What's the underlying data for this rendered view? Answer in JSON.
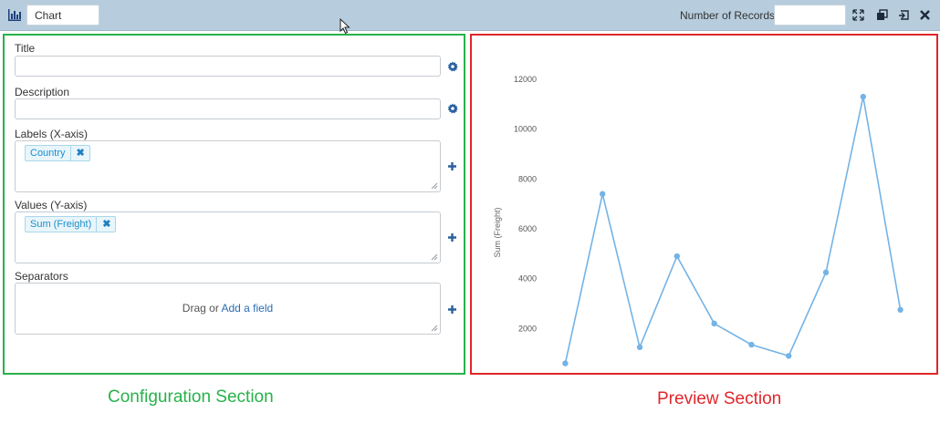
{
  "toolbar": {
    "chart_name": "Chart",
    "records_label": "Number of Records",
    "records_value": "",
    "icons": [
      "bar-chart-icon",
      "expand-icon",
      "popout-icon",
      "restore-icon",
      "close-icon"
    ]
  },
  "config": {
    "title_label": "Title",
    "title_value": "",
    "description_label": "Description",
    "description_value": "",
    "labels_label": "Labels (X-axis)",
    "labels_chip": "Country",
    "values_label": "Values (Y-axis)",
    "values_chip": "Sum (Freight)",
    "separators_label": "Separators",
    "drag_text": "Drag or ",
    "add_field_link": "Add a field",
    "remove_symbol": "✖"
  },
  "captions": {
    "config": "Configuration Section",
    "preview": "Preview Section"
  },
  "colors": {
    "config_border": "#27b24a",
    "preview_border": "#e0262a",
    "series": "#74b3e6",
    "chip": "#1e8fc9"
  },
  "chart_data": {
    "type": "line",
    "ylabel": "Sum (Freight)",
    "xlabel": "",
    "ylim": [
      0,
      12000
    ],
    "yticks": [
      0,
      2000,
      4000,
      6000,
      8000,
      10000,
      12000
    ],
    "x": [
      1,
      2,
      3,
      4,
      5,
      6,
      7,
      8,
      9,
      10
    ],
    "values": [
      600,
      7400,
      1250,
      4900,
      2200,
      1350,
      900,
      4250,
      11300,
      2750
    ],
    "grid": false
  }
}
